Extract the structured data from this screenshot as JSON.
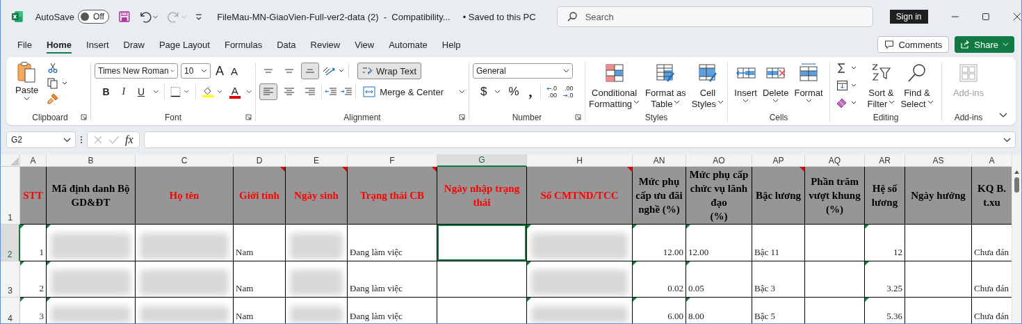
{
  "title_bar": {
    "autosave": {
      "label": "AutoSave",
      "toggle": {
        "text": "Off",
        "on": false
      }
    },
    "document_title": "FileMau-MN-GiaoVien-Full-ver2-data (2)  -  Compatibility...",
    "save_status": "• Saved to this PC",
    "search": {
      "placeholder": "Search"
    },
    "sign_in": "Sign in"
  },
  "menu_tabs": [
    {
      "label": "File",
      "selected": false
    },
    {
      "label": "Home",
      "selected": true
    },
    {
      "label": "Insert",
      "selected": false
    },
    {
      "label": "Draw",
      "selected": false
    },
    {
      "label": "Page Layout",
      "selected": false
    },
    {
      "label": "Formulas",
      "selected": false
    },
    {
      "label": "Data",
      "selected": false
    },
    {
      "label": "Review",
      "selected": false
    },
    {
      "label": "View",
      "selected": false
    },
    {
      "label": "Automate",
      "selected": false
    },
    {
      "label": "Help",
      "selected": false
    }
  ],
  "comments": "Comments",
  "share": "Share",
  "ribbon": {
    "clipboard": {
      "label": "Clipboard",
      "paste": "Paste"
    },
    "font": {
      "label": "Font",
      "name": "Times New Roman",
      "size": "10",
      "grow": "A",
      "shrink": "A",
      "styles": [
        {
          "kind": "bold",
          "text": "B"
        },
        {
          "kind": "italic",
          "text": "I"
        },
        {
          "kind": "underline",
          "text": "U"
        }
      ],
      "color_glyph": "A"
    },
    "alignment": {
      "label": "Alignment",
      "vertical": [
        {
          "kind": "top",
          "selected": false
        },
        {
          "kind": "middle",
          "selected": false
        },
        {
          "kind": "bottom",
          "selected": true
        }
      ],
      "horizontal": [
        {
          "kind": "left",
          "selected": true
        },
        {
          "kind": "center",
          "selected": false
        },
        {
          "kind": "right",
          "selected": false
        }
      ],
      "wrap_text": {
        "text": "Wrap Text",
        "on": true
      },
      "merge": "Merge & Center"
    },
    "number": {
      "label": "Number",
      "format": "General",
      "currency": "$",
      "percent": "%",
      "comma": ",",
      "decimals": [
        {
          "kind": "increase",
          "top": ".0",
          "bottom": ".00"
        },
        {
          "kind": "decrease",
          "top": ".00",
          "bottom": ".0"
        }
      ]
    },
    "styles": {
      "label": "Styles",
      "buttons": [
        {
          "kind": "conditional",
          "lines": [
            "Conditional",
            "Formatting"
          ]
        },
        {
          "kind": "table",
          "lines": [
            "Format as",
            "Table"
          ]
        },
        {
          "kind": "cell_styles",
          "lines": [
            "Cell",
            "Styles"
          ]
        }
      ]
    },
    "cells": {
      "label": "Cells",
      "buttons": [
        {
          "kind": "insert",
          "lines": [
            "Insert"
          ]
        },
        {
          "kind": "delete",
          "lines": [
            "Delete"
          ]
        },
        {
          "kind": "format",
          "lines": [
            "Format"
          ]
        }
      ]
    },
    "editing": {
      "label": "Editing",
      "buttons": [
        {
          "kind": "sort",
          "lines": [
            "Sort &",
            "Filter"
          ]
        },
        {
          "kind": "find",
          "lines": [
            "Find &",
            "Select"
          ]
        }
      ]
    },
    "addins": {
      "label": "Add-ins",
      "button": {
        "text": "Add-ins",
        "disabled": true
      }
    }
  },
  "formula_bar": {
    "name_box": "G2",
    "fx": "fx"
  },
  "sheet": {
    "columns": [
      {
        "letter": "A",
        "selected": false,
        "kind": "number"
      },
      {
        "letter": "B",
        "selected": false,
        "kind": "text"
      },
      {
        "letter": "C",
        "selected": false,
        "kind": "text"
      },
      {
        "letter": "D",
        "selected": false,
        "kind": "text"
      },
      {
        "letter": "E",
        "selected": false,
        "kind": "text"
      },
      {
        "letter": "F",
        "selected": false,
        "kind": "text"
      },
      {
        "letter": "G",
        "selected": true,
        "kind": "text"
      },
      {
        "letter": "H",
        "selected": false,
        "kind": "text"
      },
      {
        "letter": "AN",
        "selected": false,
        "kind": "number"
      },
      {
        "letter": "AO",
        "selected": false,
        "kind": "text"
      },
      {
        "letter": "AP",
        "selected": false,
        "kind": "text"
      },
      {
        "letter": "AQ",
        "selected": false,
        "kind": "text"
      },
      {
        "letter": "AR",
        "selected": false,
        "kind": "number"
      },
      {
        "letter": "AS",
        "selected": false,
        "kind": "text"
      },
      {
        "letter": "A",
        "selected": false,
        "kind": "text"
      }
    ],
    "header_row": {
      "number": "1",
      "cells": [
        {
          "text": "STT",
          "color": "#ff0000",
          "comment": false
        },
        {
          "text": "Mã định danh Bộ GD&ĐT",
          "color": "#000000",
          "comment": false
        },
        {
          "text": "Họ tên",
          "color": "#ff0000",
          "comment": false
        },
        {
          "text": "Giới tính",
          "color": "#ff0000",
          "comment": true
        },
        {
          "text": "Ngày sinh",
          "color": "#ff0000",
          "comment": true
        },
        {
          "text": "Trạng thái CB",
          "color": "#ff0000",
          "comment": true
        },
        {
          "text": "Ngày nhập trạng thái",
          "color": "#ff0000",
          "comment": false
        },
        {
          "text": "Số CMTND/TCC",
          "color": "#ff0000",
          "comment": true
        },
        {
          "text": "Mức phụ cấp ưu đãi nghề (%)",
          "color": "#000000",
          "comment": false
        },
        {
          "text": "Mức phụ cấp chức vụ lãnh đạo\n(%)",
          "color": "#000000",
          "comment": false
        },
        {
          "text": "Bậc lương",
          "color": "#000000",
          "comment": true
        },
        {
          "text": "Phần trăm vượt khung (%)",
          "color": "#000000",
          "comment": false
        },
        {
          "text": "Hệ số lương",
          "color": "#000000",
          "comment": false
        },
        {
          "text": "Ngày hưởng",
          "color": "#000000",
          "comment": false
        },
        {
          "text": "KQ B.\nt.xu",
          "color": "#000000",
          "comment": false
        }
      ]
    },
    "rows": [
      {
        "number": "2",
        "selected": true,
        "cells": [
          {
            "text": "1",
            "flag": true,
            "selected": false
          },
          {
            "blurred": true,
            "flag": true,
            "selected": false
          },
          {
            "blurred": true,
            "flag": false,
            "selected": false
          },
          {
            "text": "Nam",
            "flag": false,
            "selected": false
          },
          {
            "blurred": true,
            "flag": false,
            "selected": false
          },
          {
            "text": "Đang làm việc",
            "flag": false,
            "selected": false
          },
          {
            "flag": false,
            "selected": true
          },
          {
            "blurred": true,
            "flag": true,
            "selected": false
          },
          {
            "text": "12.00",
            "flag": true,
            "selected": false
          },
          {
            "text": "12.00",
            "flag": true,
            "selected": false
          },
          {
            "text": "Bậc 11",
            "flag": false,
            "selected": false
          },
          {
            "flag": false,
            "selected": false
          },
          {
            "text": "12",
            "flag": true,
            "selected": false
          },
          {
            "flag": false,
            "selected": false
          },
          {
            "text": "Chưa đán",
            "flag": false,
            "selected": false
          }
        ]
      },
      {
        "number": "3",
        "selected": false,
        "cells": [
          {
            "text": "2",
            "flag": true,
            "selected": false
          },
          {
            "blurred": true,
            "flag": true,
            "selected": false
          },
          {
            "blurred": true,
            "flag": false,
            "selected": false
          },
          {
            "text": "Nam",
            "flag": false,
            "selected": false
          },
          {
            "blurred": true,
            "flag": false,
            "selected": false
          },
          {
            "text": "Đang làm việc",
            "flag": false,
            "selected": false
          },
          {
            "flag": false,
            "selected": false
          },
          {
            "blurred": true,
            "flag": true,
            "selected": false
          },
          {
            "text": "0.02",
            "flag": true,
            "selected": false
          },
          {
            "text": "0.05",
            "flag": true,
            "selected": false
          },
          {
            "text": "Bậc 3",
            "flag": false,
            "selected": false
          },
          {
            "flag": false,
            "selected": false
          },
          {
            "text": "3.25",
            "flag": true,
            "selected": false
          },
          {
            "flag": false,
            "selected": false
          },
          {
            "text": "Chưa đán",
            "flag": false,
            "selected": false
          }
        ]
      },
      {
        "number": "4",
        "selected": false,
        "cells": [
          {
            "text": "3",
            "flag": true,
            "selected": false
          },
          {
            "blurred": true,
            "flag": true,
            "selected": false
          },
          {
            "blurred": true,
            "flag": false,
            "selected": false
          },
          {
            "text": "Nam",
            "flag": false,
            "selected": false
          },
          {
            "blurred": true,
            "flag": false,
            "selected": false
          },
          {
            "text": "Đang làm việc",
            "flag": false,
            "selected": false
          },
          {
            "flag": false,
            "selected": false
          },
          {
            "blurred": true,
            "flag": true,
            "selected": false
          },
          {
            "text": "6.00",
            "flag": true,
            "selected": false
          },
          {
            "text": "8.00",
            "flag": true,
            "selected": false
          },
          {
            "text": "Bậc 5",
            "flag": false,
            "selected": false
          },
          {
            "flag": false,
            "selected": false
          },
          {
            "text": "5.36",
            "flag": true,
            "selected": false
          },
          {
            "flag": false,
            "selected": false
          },
          {
            "text": "Chưa đán",
            "flag": false,
            "selected": false
          }
        ]
      }
    ]
  }
}
